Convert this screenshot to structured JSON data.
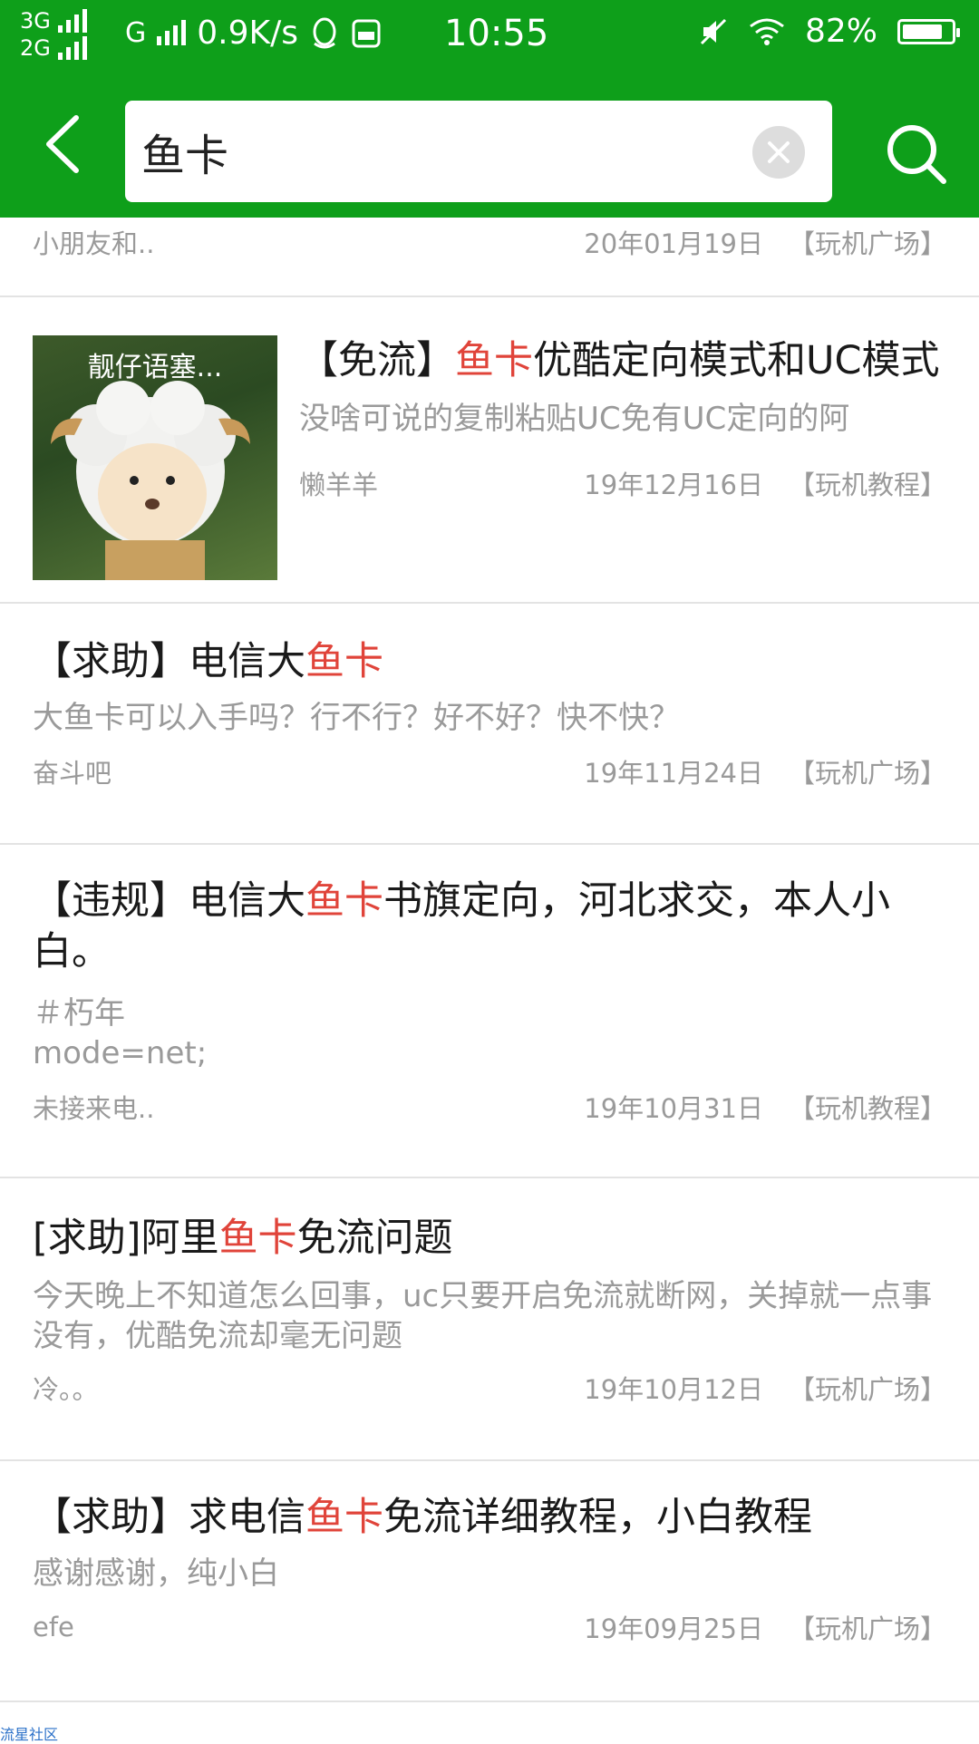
{
  "status_bar": {
    "net1": "3G",
    "net2": "2G",
    "carrier_g": "G",
    "speed": "0.9K/s",
    "time": "10:55",
    "battery_pct": "82%",
    "battery_level": 0.82,
    "icons": [
      "qq-icon",
      "vivo-icon",
      "mute-icon",
      "wifi-icon",
      "battery-icon"
    ]
  },
  "search": {
    "query": "鱼卡",
    "back_icon": "chevron-left-icon",
    "clear_icon": "clear-icon",
    "search_icon": "search-icon"
  },
  "partial_item": {
    "author": "小朋友和..",
    "date": "20年01月19日",
    "category": "【玩机广场】"
  },
  "items": [
    {
      "title_pre": "【免流】",
      "title_hl": "鱼卡",
      "title_post": "优酷定向模式和UC模式",
      "desc": "没啥可说的复制粘贴UC免有UC定向的阿",
      "author": "懒羊羊",
      "date": "19年12月16日",
      "category": "【玩机教程】",
      "thumb_caption": "靓仔语塞..."
    },
    {
      "title_pre": "【求助】电信大",
      "title_hl": "鱼卡",
      "title_post": "",
      "desc": "大鱼卡可以入手吗？行不行？好不好？快不快？",
      "author": "奋斗吧",
      "date": "19年11月24日",
      "category": "【玩机广场】"
    },
    {
      "title_pre": "【违规】电信大",
      "title_hl": "鱼卡",
      "title_post": "书旗定向，河北求交，本人小白。",
      "desc_line1": "＃朽年",
      "desc_line2": "mode=net;",
      "author": "未接来电..",
      "date": "19年10月31日",
      "category": "【玩机教程】"
    },
    {
      "title_pre": "[求助]阿里",
      "title_hl": "鱼卡",
      "title_post": "免流问题",
      "desc": "今天晚上不知道怎么回事，uc只要开启免流就断网，关掉就一点事没有，优酷免流却毫无问题",
      "author": "冷。。",
      "date": "19年10月12日",
      "category": "【玩机广场】"
    },
    {
      "title_pre": "【求助】求电信",
      "title_hl": "鱼卡",
      "title_post": "免流详细教程，小白教程",
      "desc": "感谢感谢，纯小白",
      "author": "efe",
      "date": "19年09月25日",
      "category": "【玩机广场】"
    }
  ],
  "watermark": "流星社区"
}
